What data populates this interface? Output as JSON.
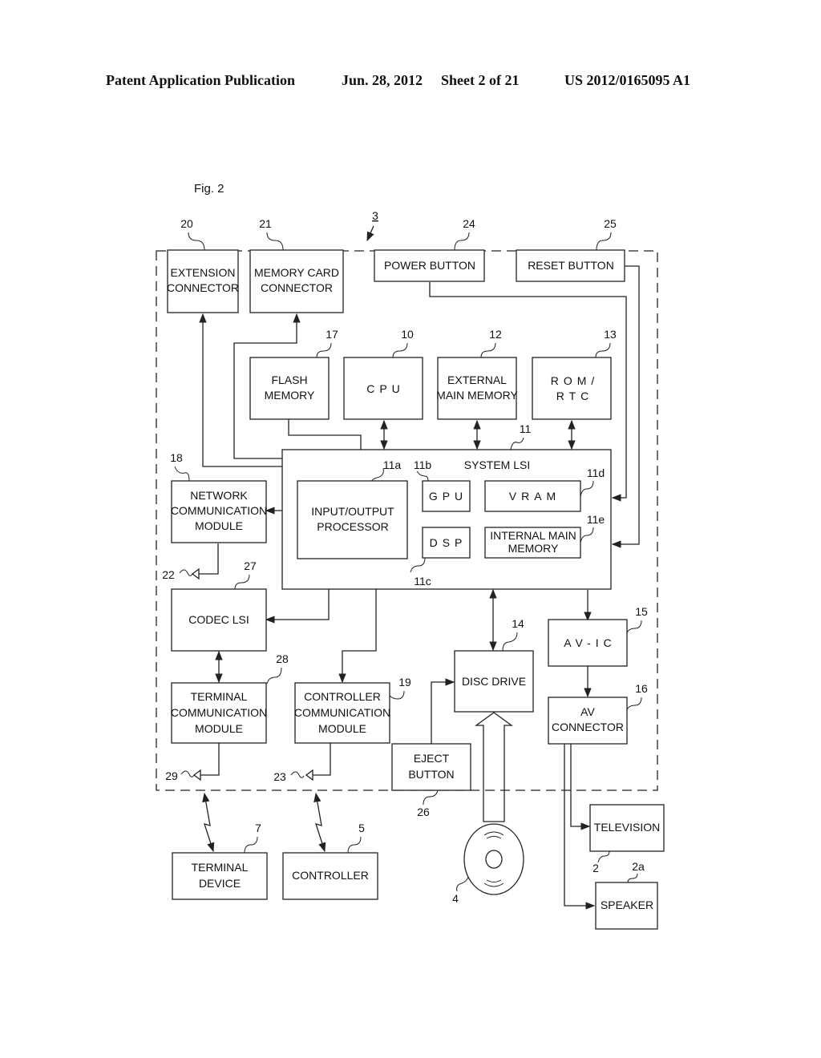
{
  "header": {
    "publication": "Patent Application Publication",
    "date": "Jun. 28, 2012",
    "sheet": "Sheet 2 of 21",
    "number": "US 2012/0165095 A1"
  },
  "figure": {
    "label": "Fig. 2",
    "device_ref": "3"
  },
  "blocks": {
    "extension_connector": {
      "ref": "20",
      "lines": [
        "EXTENSION",
        "CONNECTOR"
      ]
    },
    "memory_card_connector": {
      "ref": "21",
      "lines": [
        "MEMORY CARD",
        "CONNECTOR"
      ]
    },
    "power_button": {
      "ref": "24",
      "lines": [
        "POWER BUTTON"
      ]
    },
    "reset_button": {
      "ref": "25",
      "lines": [
        "RESET BUTTON"
      ]
    },
    "flash_memory": {
      "ref": "17",
      "lines": [
        "FLASH",
        "MEMORY"
      ]
    },
    "cpu": {
      "ref": "10",
      "lines": [
        "CPU"
      ]
    },
    "external_main_memory": {
      "ref": "12",
      "lines": [
        "EXTERNAL",
        "MAIN MEMORY"
      ]
    },
    "rom_rtc": {
      "ref": "13",
      "lines": [
        "ROM/",
        "RTC"
      ]
    },
    "system_lsi": {
      "ref": "11",
      "lines": [
        "SYSTEM LSI"
      ]
    },
    "io_processor": {
      "ref": "11a",
      "lines": [
        "INPUT/OUTPUT",
        "PROCESSOR"
      ]
    },
    "gpu": {
      "ref": "11b",
      "lines": [
        "GPU"
      ]
    },
    "dsp": {
      "ref": "11c",
      "lines": [
        "DSP"
      ]
    },
    "vram": {
      "ref": "11d",
      "lines": [
        "VRAM"
      ]
    },
    "internal_main_memory": {
      "ref": "11e",
      "lines": [
        "INTERNAL MAIN",
        "MEMORY"
      ]
    },
    "network_module": {
      "ref": "18",
      "lines": [
        "NETWORK",
        "COMMUNICATION",
        "MODULE"
      ]
    },
    "codec_lsi": {
      "ref": "27",
      "lines": [
        "CODEC LSI"
      ]
    },
    "terminal_module": {
      "ref": "28",
      "lines": [
        "TERMINAL",
        "COMMUNICATION",
        "MODULE"
      ]
    },
    "controller_module": {
      "ref": "19",
      "lines": [
        "CONTROLLER",
        "COMMUNICATION",
        "MODULE"
      ]
    },
    "disc_drive": {
      "ref": "14",
      "lines": [
        "DISC DRIVE"
      ]
    },
    "eject_button": {
      "ref": "26",
      "lines": [
        "EJECT",
        "BUTTON"
      ]
    },
    "av_ic": {
      "ref": "15",
      "lines": [
        "AV-IC"
      ]
    },
    "av_connector": {
      "ref": "16",
      "lines": [
        "AV",
        "CONNECTOR"
      ]
    },
    "terminal_device": {
      "ref": "7",
      "lines": [
        "TERMINAL",
        "DEVICE"
      ]
    },
    "controller": {
      "ref": "5",
      "lines": [
        "CONTROLLER"
      ]
    },
    "television": {
      "ref": "2",
      "lines": [
        "TELEVISION"
      ]
    },
    "speaker": {
      "ref": "2a",
      "lines": [
        "SPEAKER"
      ]
    }
  },
  "antennas": {
    "network": "22",
    "terminal": "29",
    "controller": "23"
  },
  "disc": {
    "ref": "4"
  }
}
